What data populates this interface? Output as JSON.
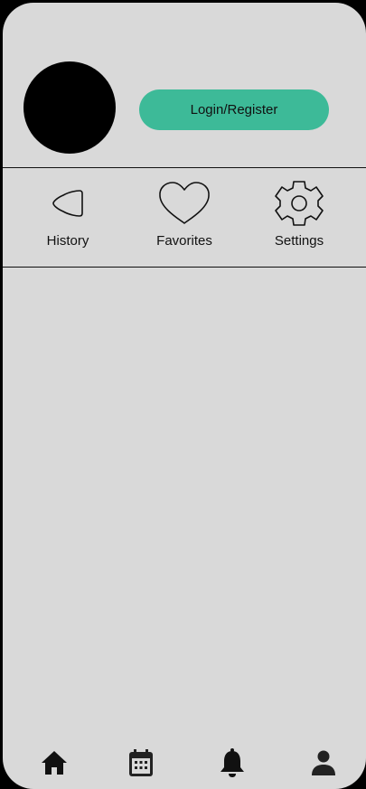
{
  "header": {
    "login_label": "Login/Register"
  },
  "quick_actions": [
    {
      "label": "History",
      "icon": "history-icon"
    },
    {
      "label": "Favorites",
      "icon": "heart-icon"
    },
    {
      "label": "Settings",
      "icon": "gear-icon"
    }
  ],
  "bottom_nav": {
    "items": [
      {
        "icon": "home-icon"
      },
      {
        "icon": "calendar-icon"
      },
      {
        "icon": "bell-icon"
      },
      {
        "icon": "profile-icon"
      }
    ]
  },
  "colors": {
    "background": "#d9d9d9",
    "accent": "#3dba98",
    "frame": "#000000"
  }
}
